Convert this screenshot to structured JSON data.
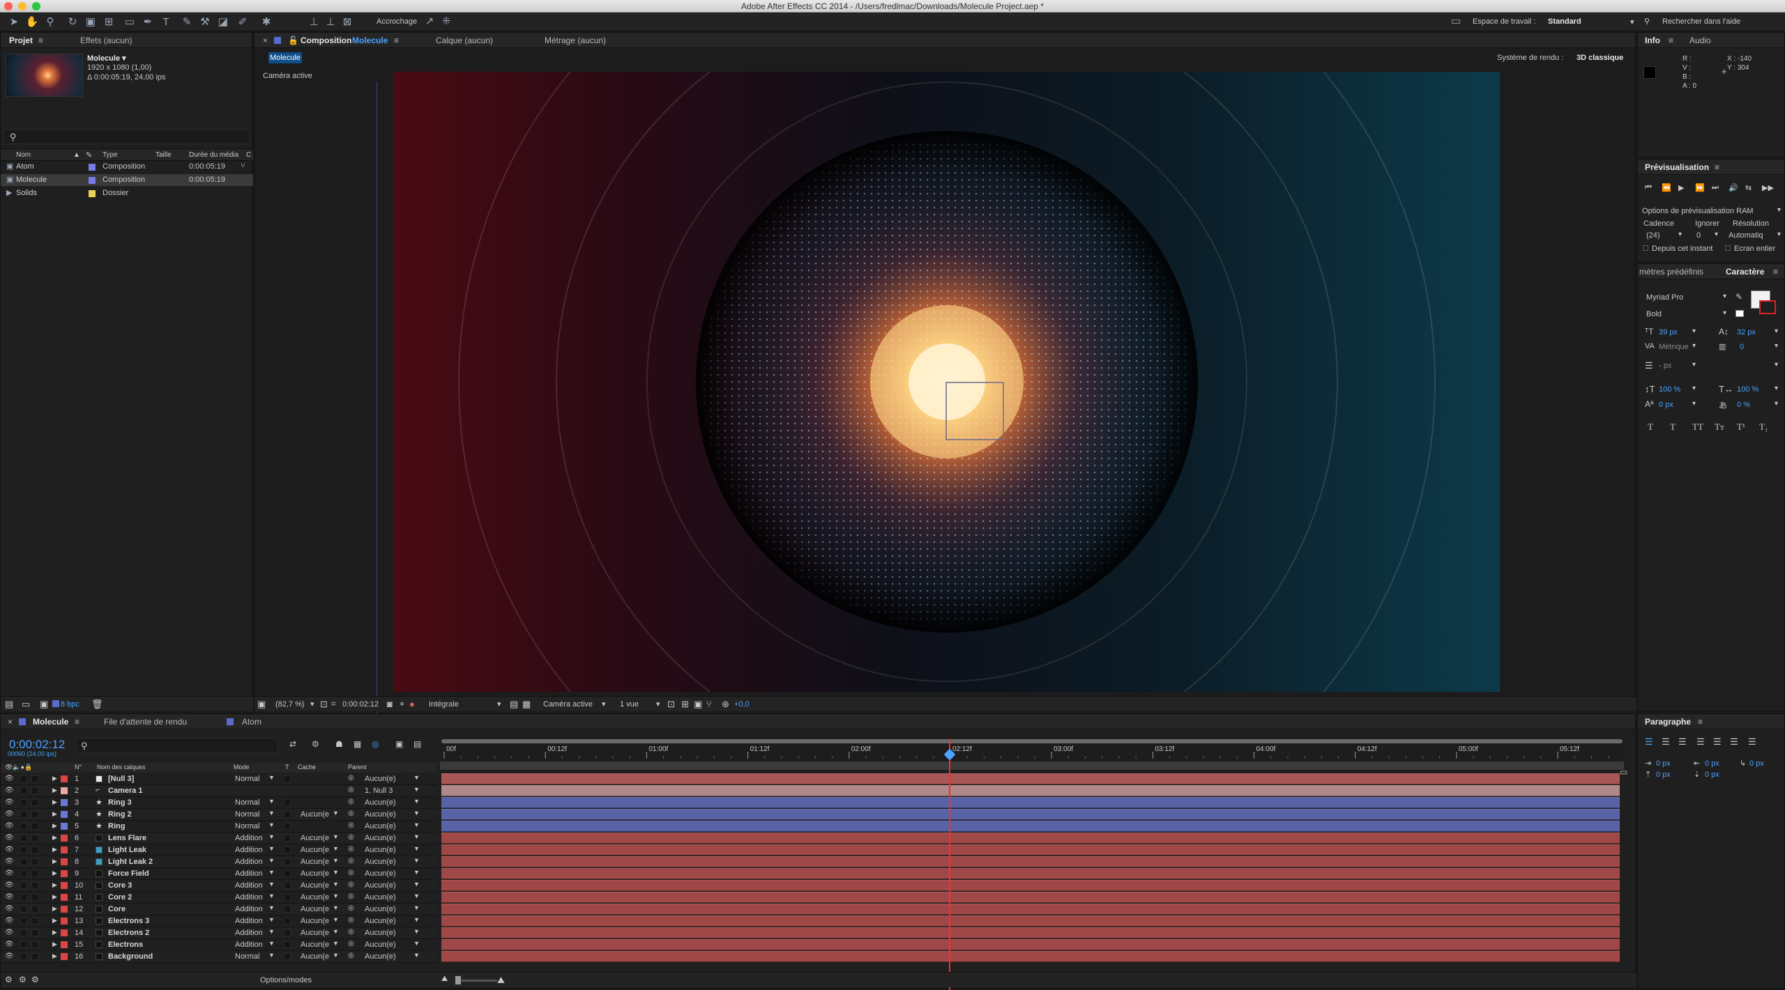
{
  "window": {
    "title": "Adobe After Effects CC 2014 - /Users/fredlmac/Downloads/Molecule Project.aep *"
  },
  "toolbar": {
    "snapping": "Accrochage",
    "workspace_label": "Espace de travail :",
    "workspace_value": "Standard",
    "help_search": "Rechercher dans l'aide"
  },
  "project_panel": {
    "tab_project": "Projet",
    "tab_effects": "Effets (aucun)",
    "selected_name": "Molecule ▾",
    "dimensions": "1920 x 1080 (1,00)",
    "duration": "Δ 0:00:05:19, 24,00 ips",
    "col_name": "Nom",
    "col_type": "Type",
    "col_size": "Taille",
    "col_duration": "Durée du média",
    "col_c": "C",
    "bpc": "8 bpc",
    "items": [
      {
        "name": "Atom",
        "type": "Composition",
        "duration": "0:00:05:19",
        "color": "#7a7ae6"
      },
      {
        "name": "Molecule",
        "type": "Composition",
        "duration": "0:00:05:19",
        "color": "#7a7ae6"
      },
      {
        "name": "Solids",
        "type": "Dossier",
        "duration": "",
        "color": "#e6d35a"
      }
    ]
  },
  "comp_panel": {
    "tab_comp_prefix": "Composition",
    "tab_comp": "Molecule",
    "tab_layer": "Calque (aucun)",
    "tab_footage": "Métrage (aucun)",
    "comp_button": "Molecule",
    "renderer_label": "Système de rendu :",
    "renderer_value": "3D classique",
    "camera_label": "Caméra active",
    "zoom": "(82,7 %)",
    "timecode": "0:00:02:12",
    "resolution": "Intégrale",
    "view": "Caméra active",
    "views": "1 vue",
    "exposure": "+0,0"
  },
  "info_panel": {
    "tab_info": "Info",
    "tab_audio": "Audio",
    "r": "R :",
    "v": "V :",
    "b": "B :",
    "a": "A : 0",
    "x": "X : -140",
    "y": "Y : 304"
  },
  "preview_panel": {
    "title": "Prévisualisation",
    "ram_options": "Options de prévisualisation RAM",
    "cadence_label": "Cadence",
    "ignore_label": "Ignorer",
    "resolution_label": "Résolution",
    "cadence_value": "(24)",
    "ignore_value": "0",
    "resolution_value": "Automatiq",
    "from_current": "Depuis cet instant",
    "full_screen": "Ecran entier"
  },
  "character_panel": {
    "tab_presets": "mètres prédéfinis",
    "tab_character": "Caractère",
    "font": "Myriad Pro",
    "style": "Bold",
    "size": "39 px",
    "leading": "32 px",
    "kerning": "Métrique",
    "tracking": "0",
    "stroke": "- px",
    "vscale": "100 %",
    "hscale": "100 %",
    "baseline": "0 px",
    "tsume": "0 %",
    "styles": [
      "T",
      "T",
      "TT",
      "Tт",
      "T¹",
      "T₁"
    ]
  },
  "paragraph_panel": {
    "title": "Paragraphe",
    "indent_left": "0 px",
    "indent_right": "0 px",
    "indent_first": "0 px",
    "space_before": "0 px",
    "space_after": "0 px"
  },
  "timeline": {
    "tab_comp": "Molecule",
    "tab_queue": "File d'attente de rendu",
    "tab_atom": "Atom",
    "timecode": "0:00:02:12",
    "frame_info": "00060 (24.00 ips)",
    "col_num": "N°",
    "col_name": "Nom des calques",
    "col_mode": "Mode",
    "col_t": "T",
    "col_cache": "Cache",
    "col_parent": "Parent",
    "toggle_label": "Options/modes",
    "ruler": [
      "00f",
      "00:12f",
      "01:00f",
      "01:12f",
      "02:00f",
      "02:12f",
      "03:00f",
      "03:12f",
      "04:00f",
      "04:12f",
      "05:00f",
      "05:12f"
    ],
    "playhead_fraction": 0.4305,
    "layers": [
      {
        "num": "1",
        "name": "[Null 3]",
        "mode": "Normal",
        "cache": "",
        "parent": "Aucun(e)",
        "label": "#d44",
        "bar": "#a85656",
        "swatch": "#e8e8e8",
        "star": false
      },
      {
        "num": "2",
        "name": "Camera 1",
        "mode": "",
        "cache": "",
        "parent": "1. Null 3",
        "label": "#e8a8a8",
        "bar": "#b08888",
        "swatch": "",
        "star": false
      },
      {
        "num": "3",
        "name": "Ring 3",
        "mode": "Normal",
        "cache": "",
        "parent": "Aucun(e)",
        "label": "#6a78d4",
        "bar": "#5a62a6",
        "swatch": "",
        "star": true
      },
      {
        "num": "4",
        "name": "Ring 2",
        "mode": "Normal",
        "cache": "Aucun(e",
        "parent": "Aucun(e)",
        "label": "#6a78d4",
        "bar": "#5a62a6",
        "swatch": "",
        "star": true
      },
      {
        "num": "5",
        "name": "Ring",
        "mode": "Normal",
        "cache": "",
        "parent": "Aucun(e)",
        "label": "#6a78d4",
        "bar": "#5a62a6",
        "swatch": "",
        "star": true
      },
      {
        "num": "6",
        "name": "Lens Flare",
        "mode": "Addition",
        "cache": "Aucun(e",
        "parent": "Aucun(e)",
        "label": "#d44",
        "bar": "#a04848",
        "swatch": "#111",
        "star": false
      },
      {
        "num": "7",
        "name": "Light Leak",
        "mode": "Addition",
        "cache": "Aucun(e",
        "parent": "Aucun(e)",
        "label": "#d44",
        "bar": "#a04848",
        "swatch": "#3aa0c8",
        "star": false
      },
      {
        "num": "8",
        "name": "Light Leak 2",
        "mode": "Addition",
        "cache": "Aucun(e",
        "parent": "Aucun(e)",
        "label": "#d44",
        "bar": "#a04848",
        "swatch": "#3aa0c8",
        "star": false
      },
      {
        "num": "9",
        "name": "Force Field",
        "mode": "Addition",
        "cache": "Aucun(e",
        "parent": "Aucun(e)",
        "label": "#d44",
        "bar": "#a04848",
        "swatch": "#111",
        "star": false
      },
      {
        "num": "10",
        "name": "Core 3",
        "mode": "Addition",
        "cache": "Aucun(e",
        "parent": "Aucun(e)",
        "label": "#d44",
        "bar": "#a04848",
        "swatch": "#111",
        "star": false
      },
      {
        "num": "11",
        "name": "Core 2",
        "mode": "Addition",
        "cache": "Aucun(e",
        "parent": "Aucun(e)",
        "label": "#d44",
        "bar": "#a04848",
        "swatch": "#111",
        "star": false
      },
      {
        "num": "12",
        "name": "Core",
        "mode": "Addition",
        "cache": "Aucun(e",
        "parent": "Aucun(e)",
        "label": "#d44",
        "bar": "#a04848",
        "swatch": "#111",
        "star": false
      },
      {
        "num": "13",
        "name": "Electrons 3",
        "mode": "Addition",
        "cache": "Aucun(e",
        "parent": "Aucun(e)",
        "label": "#d44",
        "bar": "#a04848",
        "swatch": "#111",
        "star": false
      },
      {
        "num": "14",
        "name": "Electrons 2",
        "mode": "Addition",
        "cache": "Aucun(e",
        "parent": "Aucun(e)",
        "label": "#d44",
        "bar": "#a04848",
        "swatch": "#111",
        "star": false
      },
      {
        "num": "15",
        "name": "Electrons",
        "mode": "Addition",
        "cache": "Aucun(e",
        "parent": "Aucun(e)",
        "label": "#d44",
        "bar": "#a04848",
        "swatch": "#111",
        "star": false
      },
      {
        "num": "16",
        "name": "Background",
        "mode": "Normal",
        "cache": "Aucun(e",
        "parent": "Aucun(e)",
        "label": "#d44",
        "bar": "#a04848",
        "swatch": "#111",
        "star": false
      }
    ]
  },
  "colors": {
    "accent": "#4aa3ff",
    "playhead": "#ff2a2a"
  }
}
